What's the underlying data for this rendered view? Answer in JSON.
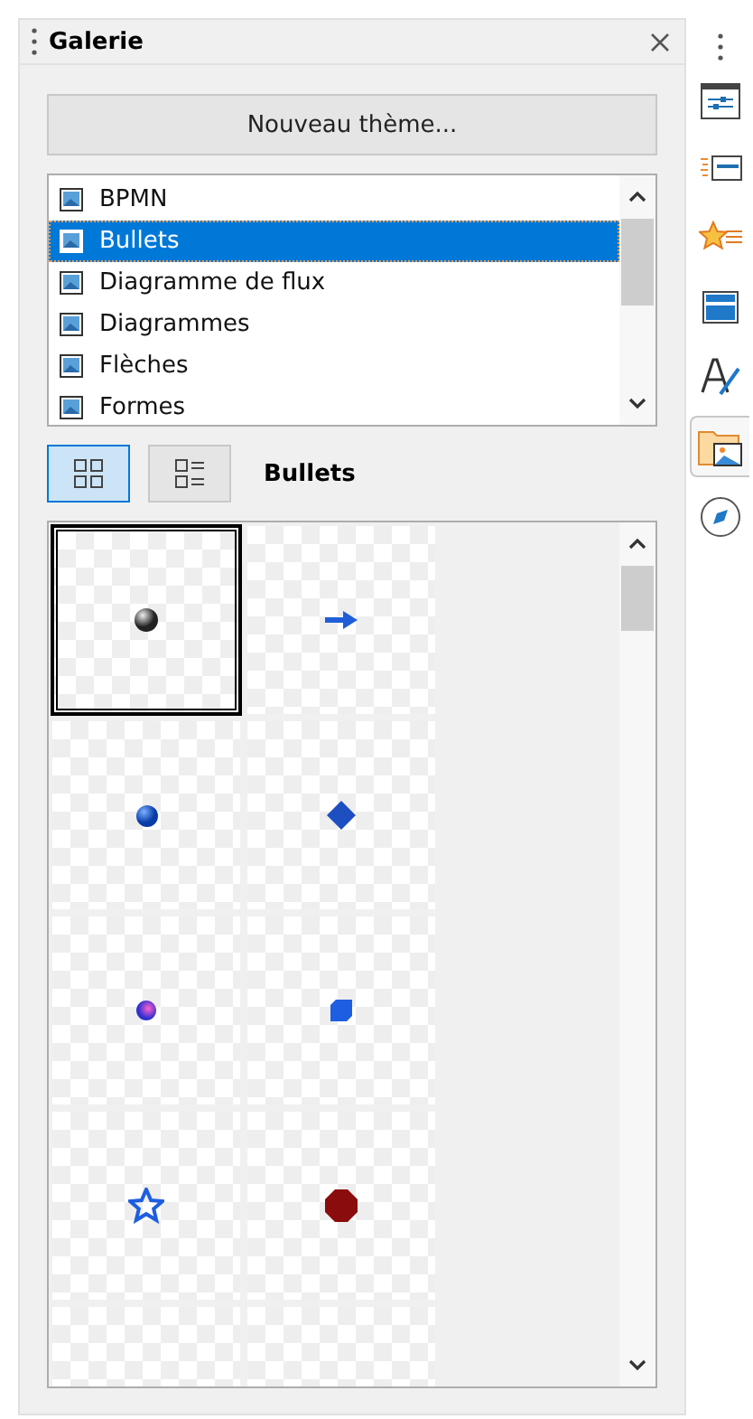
{
  "panel": {
    "title": "Galerie"
  },
  "new_theme_button": "Nouveau thème...",
  "themes": [
    {
      "label": "BPMN",
      "selected": false
    },
    {
      "label": "Bullets",
      "selected": true
    },
    {
      "label": "Diagramme de flux",
      "selected": false
    },
    {
      "label": "Diagrammes",
      "selected": false
    },
    {
      "label": "Flèches",
      "selected": false
    },
    {
      "label": "Formes",
      "selected": false
    }
  ],
  "view_modes": [
    {
      "kind": "icons",
      "selected": true
    },
    {
      "kind": "details",
      "selected": false
    }
  ],
  "current_theme": "Bullets",
  "gallery": [
    {
      "kind": "grey-sphere",
      "selected": true
    },
    {
      "kind": "arrow",
      "selected": false
    },
    {
      "kind": "blue-sphere",
      "selected": false
    },
    {
      "kind": "diamond",
      "selected": false
    },
    {
      "kind": "gem",
      "selected": false
    },
    {
      "kind": "square",
      "selected": false
    },
    {
      "kind": "star",
      "selected": false
    },
    {
      "kind": "red-sphere",
      "selected": false
    },
    {
      "kind": "blank",
      "selected": false
    },
    {
      "kind": "blank",
      "selected": false
    }
  ],
  "sidebar_tabs": [
    {
      "kind": "properties",
      "selected": false
    },
    {
      "kind": "styles",
      "selected": false
    },
    {
      "kind": "animation",
      "selected": false
    },
    {
      "kind": "master",
      "selected": false
    },
    {
      "kind": "fontwork",
      "selected": false
    },
    {
      "kind": "gallery",
      "selected": true
    },
    {
      "kind": "navigator",
      "selected": false
    }
  ]
}
